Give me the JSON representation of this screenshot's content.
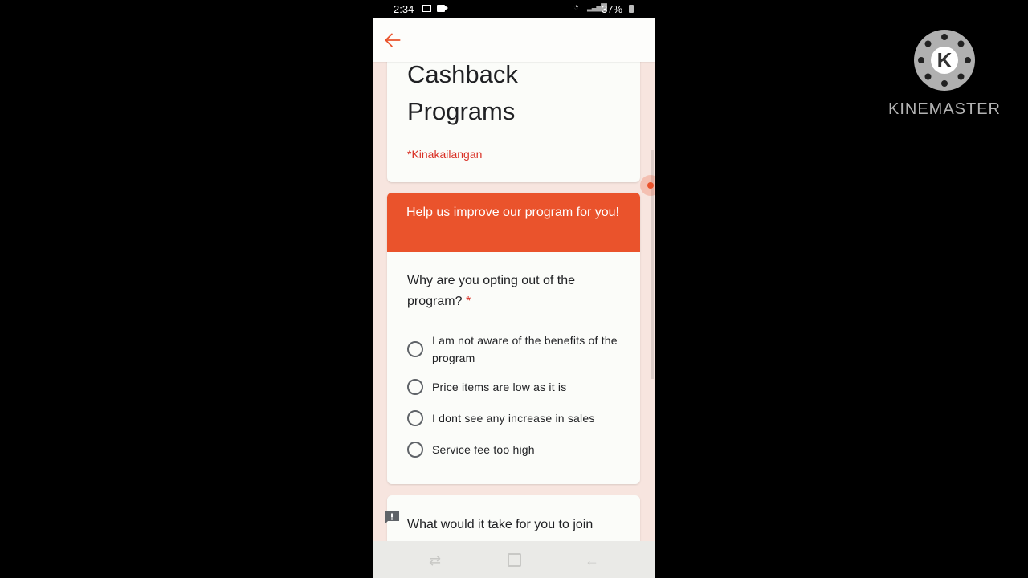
{
  "status_bar": {
    "time": "2:34",
    "battery": "37%"
  },
  "form": {
    "title": "Cashback Programs",
    "required_note": "*Kinakailangan",
    "section_title": "Help us improve our program for you!",
    "question_1": {
      "text": "Why are you opting out of the program?",
      "required_marker": "*",
      "options": [
        "I am not aware of the benefits of the program",
        "Price items are low as it is",
        "I dont see any increase in sales",
        "Service fee too high"
      ]
    },
    "question_2": {
      "text": "What would it take for you to join"
    }
  },
  "watermark": {
    "logo_letter": "K",
    "brand_text": "KINEMASTER"
  },
  "colors": {
    "accent": "#ea532c",
    "required": "#d93025",
    "page_background": "#f7e5df"
  },
  "icons": {
    "back": "arrow-left-icon",
    "feedback": "feedback-icon",
    "gallery": "gallery-icon",
    "video": "video-icon",
    "wifi": "wifi-icon",
    "signal": "signal-icon",
    "battery": "battery-icon"
  }
}
